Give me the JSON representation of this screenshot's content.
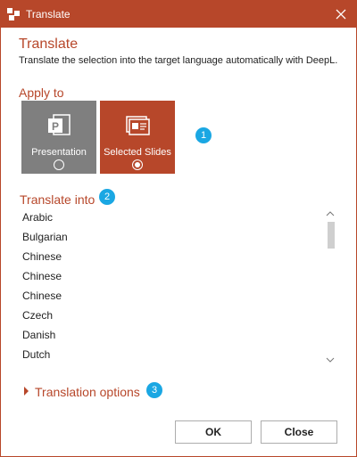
{
  "window": {
    "title": "Translate",
    "close_icon": "close-icon",
    "app_icon": "deepl-logo-icon",
    "accent_color": "#b7472a"
  },
  "header": {
    "heading": "Translate",
    "description": "Translate the selection into the target language automatically with DeepL."
  },
  "apply_to": {
    "label": "Apply to",
    "options": [
      {
        "label": "Presentation",
        "icon": "powerpoint-presentation-icon",
        "selected": false
      },
      {
        "label": "Selected Slides",
        "icon": "slides-icon",
        "selected": true
      }
    ],
    "badge": "1"
  },
  "translate_into": {
    "label": "Translate into",
    "badge": "2",
    "languages": [
      "Arabic",
      "Bulgarian",
      "Chinese",
      "Chinese",
      "Chinese",
      "Czech",
      "Danish",
      "Dutch"
    ]
  },
  "options": {
    "label": "Translation options",
    "badge": "3"
  },
  "buttons": {
    "ok": "OK",
    "close": "Close"
  },
  "badge_color": "#1aa7e3"
}
